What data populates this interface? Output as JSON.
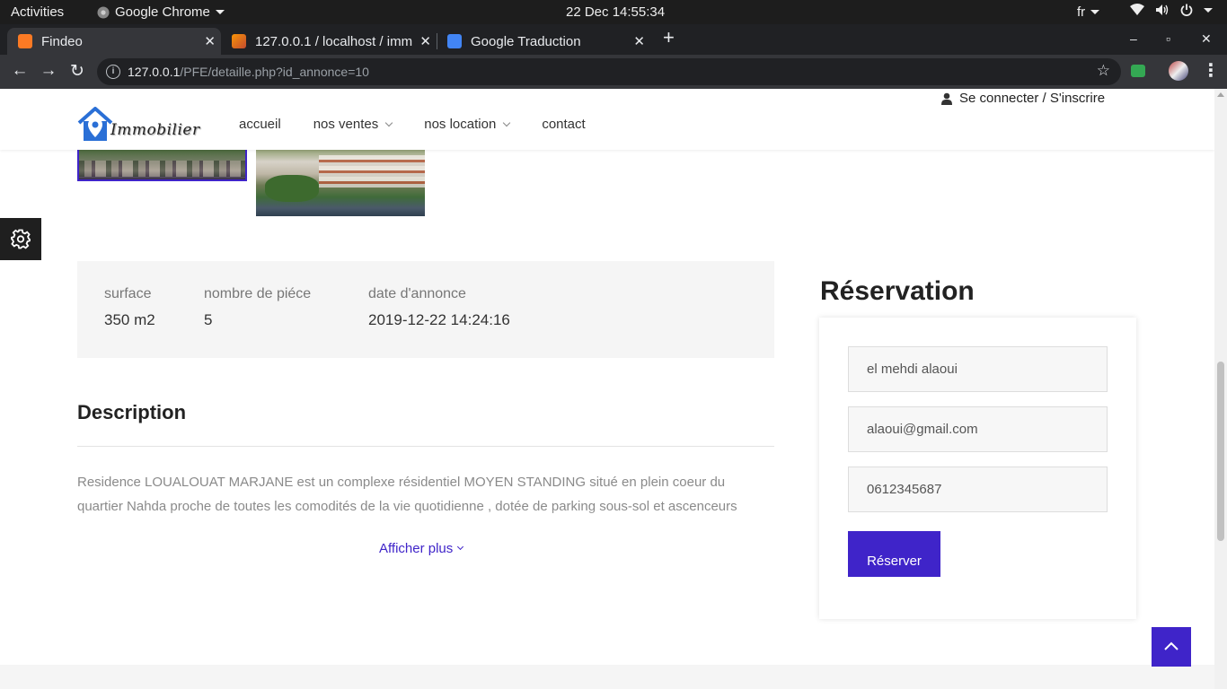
{
  "os_bar": {
    "activities": "Activities",
    "app_name": "Google Chrome",
    "clock": "22 Dec  14:55:34",
    "keyboard_layout": "fr"
  },
  "browser": {
    "tabs": [
      {
        "title": "Findeo",
        "favicon": "xampp-icon",
        "active": true
      },
      {
        "title": "127.0.0.1 / localhost / imm",
        "favicon": "phpmyadmin-icon",
        "active": false
      },
      {
        "title": "Google Traduction",
        "favicon": "google-translate-icon",
        "active": false
      }
    ],
    "url_host": "127.0.0.1",
    "url_path": "/PFE/detaille.php?id_annonce=10"
  },
  "site": {
    "brand": "Immobilier",
    "nav": [
      {
        "label": "accueil",
        "dropdown": false
      },
      {
        "label": "nos ventes",
        "dropdown": true
      },
      {
        "label": "nos location",
        "dropdown": true
      },
      {
        "label": "contact",
        "dropdown": false
      }
    ],
    "login": "Se connecter / S'inscrire"
  },
  "details": {
    "surface": {
      "label": "surface",
      "value": "350 m2"
    },
    "rooms": {
      "label": "nombre de piéce",
      "value": "5"
    },
    "date": {
      "label": "date d'annonce",
      "value": "2019-12-22 14:24:16"
    }
  },
  "description": {
    "title": "Description",
    "text": "Residence LOUALOUAT MARJANE est un complexe résidentiel MOYEN STANDING situé en plein coeur du quartier Nahda proche de toutes les comodités de la vie quotidienne , dotée de parking sous-sol et ascenceurs",
    "show_more": "Afficher plus"
  },
  "reservation": {
    "title": "Réservation",
    "name_value": "el mehdi alaoui",
    "email_value": "alaoui@gmail.com",
    "phone_value": "0612345687",
    "submit": "Réserver"
  },
  "colors": {
    "accent": "#3f24c9",
    "chrome_dark": "#202124",
    "chrome_toolbar": "#35363a"
  }
}
